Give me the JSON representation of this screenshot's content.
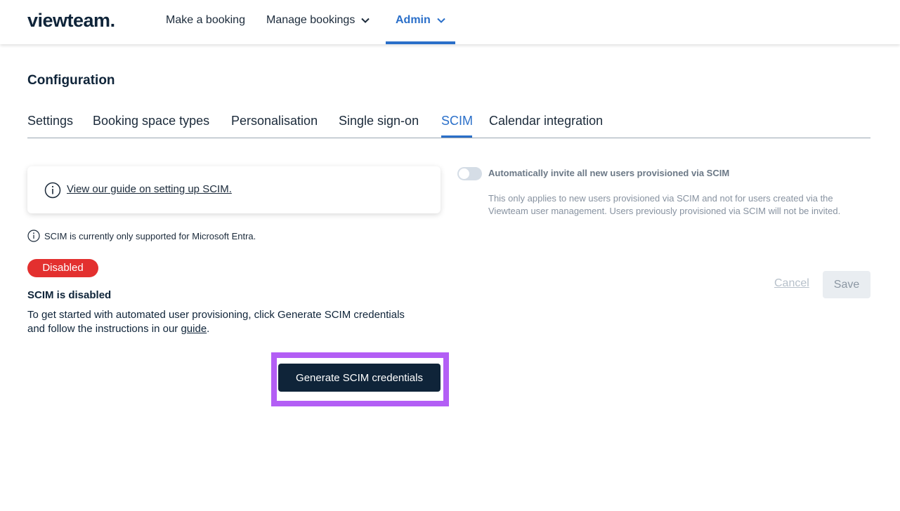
{
  "header": {
    "logo": "viewteam.",
    "nav": [
      {
        "label": "Make a booking"
      },
      {
        "label": "Manage bookings"
      },
      {
        "label": "Admin"
      }
    ]
  },
  "page": {
    "title": "Configuration",
    "tabs": [
      {
        "label": "Settings"
      },
      {
        "label": "Booking space types"
      },
      {
        "label": "Personalisation"
      },
      {
        "label": "Single sign-on"
      },
      {
        "label": "SCIM"
      },
      {
        "label": "Calendar integration"
      }
    ],
    "active_tab": "SCIM"
  },
  "scim": {
    "guide_link": "View our guide on setting up SCIM.",
    "support_note": "SCIM is currently only supported for Microsoft Entra.",
    "status_badge": "Disabled",
    "status_title": "SCIM is disabled",
    "status_desc_pre": "To get started with automated user provisioning, click Generate SCIM credentials and follow the instructions in our ",
    "status_desc_link": "guide",
    "status_desc_post": ".",
    "generate_button": "Generate SCIM credentials"
  },
  "auto_invite": {
    "label": "Automatically invite all new users provisioned via SCIM",
    "enabled": false,
    "help": "This only applies to new users provisioned via SCIM and not for users created via the Viewteam user management. Users previously provisioned via SCIM will not be invited."
  },
  "actions": {
    "cancel": "Cancel",
    "save": "Save"
  },
  "colors": {
    "brand_navy": "#0f2439",
    "accent_blue": "#2a6fc9",
    "badge_red": "#e3302f",
    "highlight_purple": "#b35ef5"
  }
}
